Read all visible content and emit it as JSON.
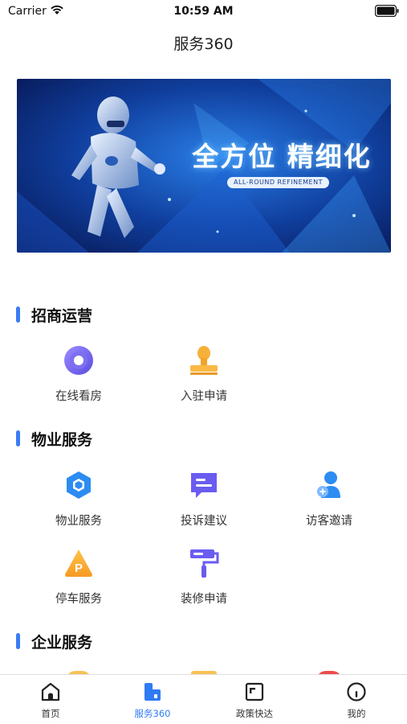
{
  "status_bar": {
    "carrier": "Carrier",
    "time": "10:59 AM"
  },
  "nav": {
    "title": "服务360"
  },
  "banner": {
    "title": "全方位 精细化",
    "subtitle": "ALL-ROUND REFINEMENT"
  },
  "sections": [
    {
      "title": "招商运营",
      "items": [
        {
          "label": "在线看房",
          "icon": "online-viewing-icon"
        },
        {
          "label": "入驻申请",
          "icon": "stamp-icon"
        }
      ]
    },
    {
      "title": "物业服务",
      "items": [
        {
          "label": "物业服务",
          "icon": "property-hexagon-icon"
        },
        {
          "label": "投诉建议",
          "icon": "complaint-message-icon"
        },
        {
          "label": "访客邀请",
          "icon": "visitor-add-icon"
        },
        {
          "label": "停车服务",
          "icon": "parking-icon"
        },
        {
          "label": "装修申请",
          "icon": "paint-roller-icon"
        }
      ]
    },
    {
      "title": "企业服务",
      "items": []
    }
  ],
  "tab_bar": {
    "tabs": [
      {
        "label": "首页",
        "icon": "home-icon",
        "active": false
      },
      {
        "label": "服务360",
        "icon": "service-icon",
        "active": true
      },
      {
        "label": "政策快达",
        "icon": "policy-icon",
        "active": false
      },
      {
        "label": "我的",
        "icon": "profile-icon",
        "active": false
      }
    ]
  },
  "colors": {
    "accent": "#2f7bf5",
    "section_bar": "#3b7cf2",
    "tab_inactive": "#333333"
  }
}
